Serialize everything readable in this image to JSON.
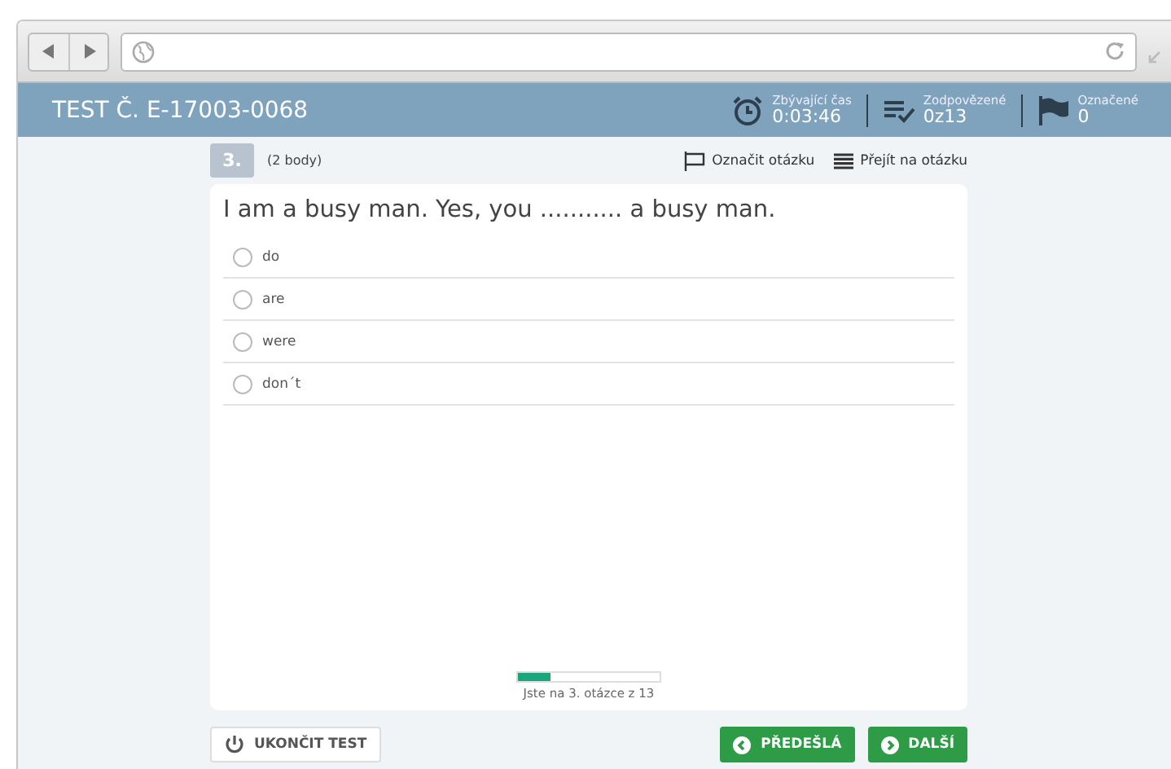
{
  "test_title": "TEST Č. E-17003-0068",
  "stats": [
    {
      "kind": "clock",
      "label": "Zbývající čas",
      "value": "0:03:46"
    },
    {
      "kind": "answered",
      "label": "Zodpovězené",
      "value": "0z13"
    },
    {
      "kind": "flag",
      "label": "Označené",
      "value": "0"
    }
  ],
  "question": {
    "number": "3.",
    "points": "(2 body)",
    "mark_link": "Označit otázku",
    "goto_link": "Přejít na otázku",
    "text": "I am a busy man. Yes, you ........... a busy man.",
    "options": [
      {
        "label": "do",
        "selected": false
      },
      {
        "label": "are",
        "selected": false
      },
      {
        "label": "were",
        "selected": false
      },
      {
        "label": "don´t",
        "selected": false
      }
    ]
  },
  "progress": {
    "level": 0.23,
    "caption": "Jste na 3. otázce z 13"
  },
  "buttons": {
    "end": "UKONČIT TEST",
    "prev": "PŘEDEŠLÁ",
    "next": "DALŠÍ"
  }
}
